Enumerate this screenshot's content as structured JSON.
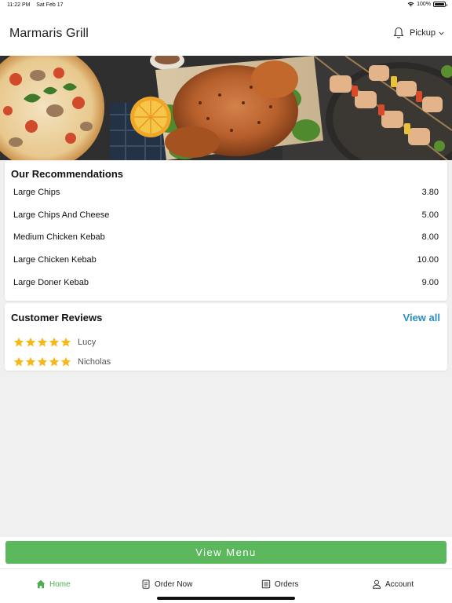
{
  "status_bar": {
    "time": "11:22 PM",
    "date": "Sat Feb 17",
    "battery": "100%"
  },
  "header": {
    "title": "Marmaris Grill",
    "order_mode": "Pickup"
  },
  "recommendations": {
    "title": "Our Recommendations",
    "items": [
      {
        "name": "Large Chips",
        "price": "3.80"
      },
      {
        "name": "Large Chips And Cheese",
        "price": "5.00"
      },
      {
        "name": "Medium Chicken Kebab",
        "price": "8.00"
      },
      {
        "name": "Large Chicken Kebab",
        "price": "10.00"
      },
      {
        "name": "Large Doner Kebab",
        "price": "9.00"
      }
    ]
  },
  "reviews": {
    "title": "Customer Reviews",
    "view_all": "View all",
    "items": [
      {
        "name": "Lucy",
        "rating": 5
      },
      {
        "name": "Nicholas",
        "rating": 5
      }
    ]
  },
  "view_menu_label": "View Menu",
  "tabs": [
    {
      "label": "Home",
      "icon": "home-icon",
      "active": true
    },
    {
      "label": "Order Now",
      "icon": "order-icon",
      "active": false
    },
    {
      "label": "Orders",
      "icon": "receipt-icon",
      "active": false
    },
    {
      "label": "Account",
      "icon": "person-icon",
      "active": false
    }
  ],
  "colors": {
    "accent_green": "#5cb85c",
    "link_blue": "#2a8dc4",
    "star_yellow": "#f7b718"
  }
}
